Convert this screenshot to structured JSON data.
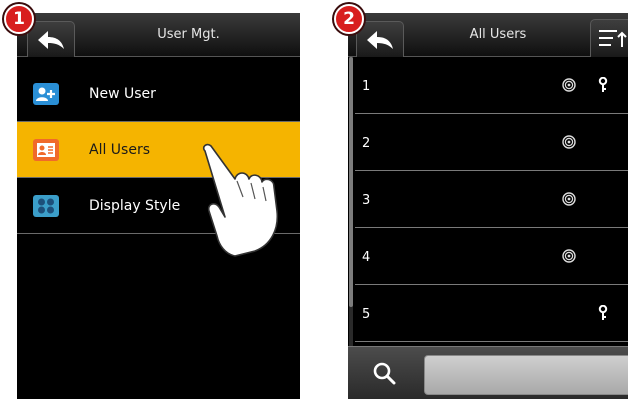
{
  "steps": [
    "1",
    "2"
  ],
  "screen1": {
    "title": "User Mgt.",
    "menu": [
      {
        "label": "New User",
        "icon": "new-user-icon"
      },
      {
        "label": "All Users",
        "icon": "all-users-icon",
        "selected": true
      },
      {
        "label": "Display Style",
        "icon": "display-style-icon"
      }
    ]
  },
  "screen2": {
    "title": "All Users",
    "users": [
      {
        "id": "1",
        "fingerprint": true,
        "password": true
      },
      {
        "id": "2",
        "fingerprint": true,
        "password": false
      },
      {
        "id": "3",
        "fingerprint": true,
        "password": false
      },
      {
        "id": "4",
        "fingerprint": true,
        "password": false
      },
      {
        "id": "5",
        "fingerprint": false,
        "password": true
      }
    ]
  },
  "colors": {
    "selected": "#f5b400",
    "badge": "#d81e1e",
    "screen_bg": "#000000"
  }
}
